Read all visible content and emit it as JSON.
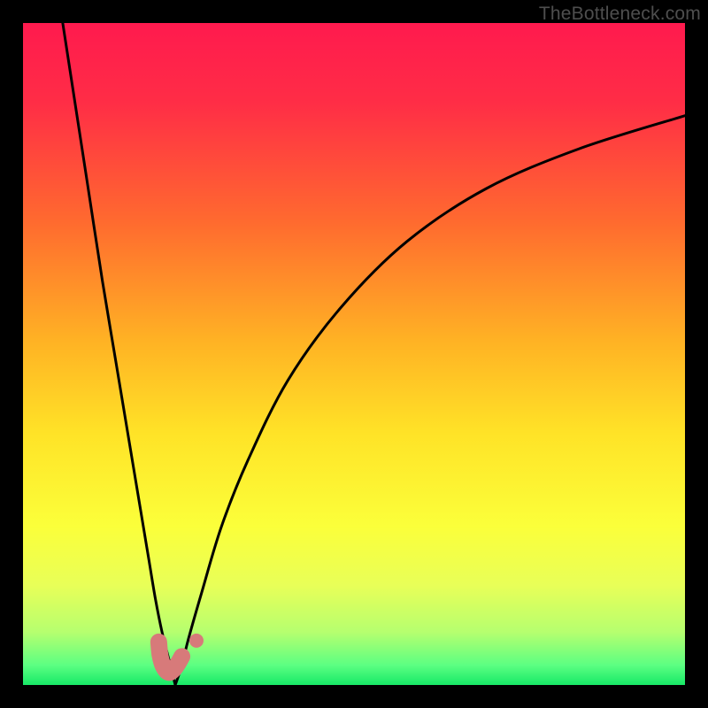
{
  "watermark": "TheBottleneck.com",
  "colors": {
    "gradient_stops": [
      {
        "pct": 0,
        "hex": "#ff1a4e"
      },
      {
        "pct": 12,
        "hex": "#ff2d46"
      },
      {
        "pct": 30,
        "hex": "#ff6a2f"
      },
      {
        "pct": 48,
        "hex": "#ffb224"
      },
      {
        "pct": 62,
        "hex": "#ffe327"
      },
      {
        "pct": 76,
        "hex": "#fbff3a"
      },
      {
        "pct": 85,
        "hex": "#e8ff58"
      },
      {
        "pct": 92,
        "hex": "#b6ff6f"
      },
      {
        "pct": 97,
        "hex": "#5cff82"
      },
      {
        "pct": 100,
        "hex": "#17e967"
      }
    ],
    "curve": "#000000",
    "marker": "#d77a7a"
  },
  "chart_data": {
    "type": "line",
    "title": "",
    "xlabel": "",
    "ylabel": "",
    "xlim": [
      0,
      100
    ],
    "ylim": [
      0,
      100
    ],
    "grid": false,
    "legend": false,
    "series": [
      {
        "name": "left-branch",
        "x": [
          6,
          8,
          10,
          12,
          14,
          16,
          18,
          19,
          20,
          21,
          22,
          22.5,
          23
        ],
        "values": [
          100,
          87,
          74,
          61,
          49,
          37,
          25,
          19,
          13,
          8,
          4,
          2,
          0
        ]
      },
      {
        "name": "right-branch",
        "x": [
          23,
          24,
          25,
          27,
          30,
          34,
          40,
          48,
          58,
          70,
          84,
          100
        ],
        "values": [
          0,
          3,
          7,
          14,
          24,
          34,
          46,
          57,
          67,
          75,
          81,
          86
        ]
      }
    ],
    "markers": [
      {
        "name": "left-hook-marker",
        "x": [
          20.5,
          20.7,
          21.2,
          22.0,
          22.8,
          23.5,
          24.0
        ],
        "values": [
          6.5,
          4.5,
          2.8,
          1.9,
          2.4,
          3.4,
          4.3
        ]
      },
      {
        "name": "right-dot-marker",
        "x": [
          26.2
        ],
        "values": [
          6.7
        ]
      }
    ]
  }
}
